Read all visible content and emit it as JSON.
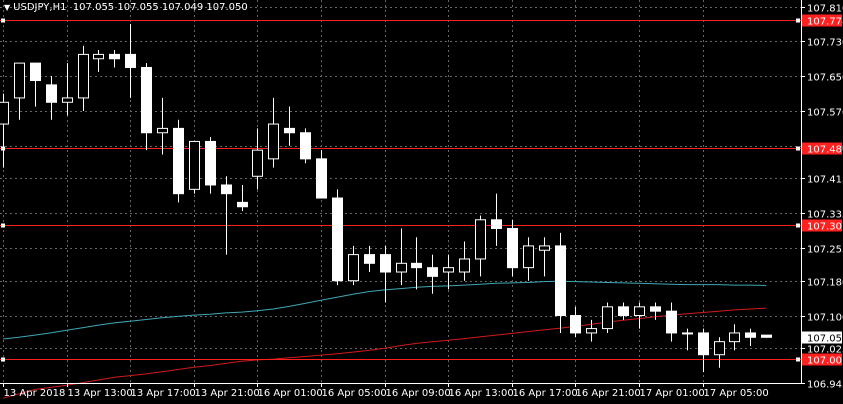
{
  "title": {
    "symbol": "USDJPY,H1",
    "ohlc": "107.055 107.055 107.049 107.050",
    "arrow_icon": "triangle-down-icon"
  },
  "colors": {
    "background": "#000000",
    "grid": "#666666",
    "frame": "#ffffff",
    "bull_body": "#000000",
    "bear_body": "#ffffff",
    "ma_fast": "#3fa7b5",
    "ma_slow": "#d11a1a",
    "hline": "#ff2020",
    "label_text": "#ffffff"
  },
  "chart_data": {
    "type": "candlestick",
    "ylim": [
      106.945,
      107.825
    ],
    "y_ticks": [
      "107.810",
      "107.730",
      "107.650",
      "107.570",
      "107.490",
      "107.415",
      "107.335",
      "107.255",
      "107.180",
      "107.100",
      "107.025",
      "106.945"
    ],
    "x_ticks": [
      "13 Apr 2018",
      "13 Apr 13:00",
      "13 Apr 17:00",
      "13 Apr 21:00",
      "16 Apr 01:00",
      "16 Apr 05:00",
      "16 Apr 09:00",
      "16 Apr 13:00",
      "16 Apr 17:00",
      "16 Apr 21:00",
      "17 Apr 01:00",
      "17 Apr 05:00"
    ],
    "x_tick_index": [
      0,
      4,
      8,
      12,
      16,
      20,
      24,
      28,
      32,
      36,
      40,
      44
    ],
    "current_price": "107.050",
    "horizontal_levels": [
      {
        "value": 107.778,
        "label": "107.778"
      },
      {
        "value": 107.486,
        "label": "107.486"
      },
      {
        "value": 107.307,
        "label": "107.307"
      },
      {
        "value": 107.001,
        "label": "107.001"
      }
    ],
    "candles": [
      {
        "o": 107.54,
        "h": 107.61,
        "l": 107.44,
        "c": 107.59
      },
      {
        "o": 107.6,
        "h": 107.68,
        "l": 107.55,
        "c": 107.68
      },
      {
        "o": 107.68,
        "h": 107.68,
        "l": 107.58,
        "c": 107.64
      },
      {
        "o": 107.63,
        "h": 107.65,
        "l": 107.55,
        "c": 107.59
      },
      {
        "o": 107.59,
        "h": 107.68,
        "l": 107.56,
        "c": 107.6
      },
      {
        "o": 107.6,
        "h": 107.72,
        "l": 107.57,
        "c": 107.7
      },
      {
        "o": 107.69,
        "h": 107.71,
        "l": 107.66,
        "c": 107.7
      },
      {
        "o": 107.7,
        "h": 107.71,
        "l": 107.67,
        "c": 107.69
      },
      {
        "o": 107.7,
        "h": 107.77,
        "l": 107.6,
        "c": 107.67
      },
      {
        "o": 107.67,
        "h": 107.68,
        "l": 107.48,
        "c": 107.52
      },
      {
        "o": 107.52,
        "h": 107.6,
        "l": 107.47,
        "c": 107.53
      },
      {
        "o": 107.53,
        "h": 107.55,
        "l": 107.36,
        "c": 107.38
      },
      {
        "o": 107.39,
        "h": 107.5,
        "l": 107.38,
        "c": 107.5
      },
      {
        "o": 107.5,
        "h": 107.51,
        "l": 107.38,
        "c": 107.4
      },
      {
        "o": 107.4,
        "h": 107.42,
        "l": 107.24,
        "c": 107.38
      },
      {
        "o": 107.36,
        "h": 107.4,
        "l": 107.34,
        "c": 107.35
      },
      {
        "o": 107.42,
        "h": 107.53,
        "l": 107.39,
        "c": 107.48
      },
      {
        "o": 107.46,
        "h": 107.6,
        "l": 107.44,
        "c": 107.54
      },
      {
        "o": 107.53,
        "h": 107.58,
        "l": 107.49,
        "c": 107.52
      },
      {
        "o": 107.52,
        "h": 107.53,
        "l": 107.45,
        "c": 107.46
      },
      {
        "o": 107.46,
        "h": 107.48,
        "l": 107.37,
        "c": 107.37
      },
      {
        "o": 107.37,
        "h": 107.39,
        "l": 107.17,
        "c": 107.18
      },
      {
        "o": 107.18,
        "h": 107.26,
        "l": 107.17,
        "c": 107.24
      },
      {
        "o": 107.24,
        "h": 107.26,
        "l": 107.2,
        "c": 107.22
      },
      {
        "o": 107.24,
        "h": 107.26,
        "l": 107.13,
        "c": 107.2
      },
      {
        "o": 107.2,
        "h": 107.3,
        "l": 107.17,
        "c": 107.22
      },
      {
        "o": 107.22,
        "h": 107.28,
        "l": 107.16,
        "c": 107.21
      },
      {
        "o": 107.21,
        "h": 107.24,
        "l": 107.15,
        "c": 107.19
      },
      {
        "o": 107.2,
        "h": 107.24,
        "l": 107.16,
        "c": 107.21
      },
      {
        "o": 107.2,
        "h": 107.27,
        "l": 107.18,
        "c": 107.23
      },
      {
        "o": 107.23,
        "h": 107.33,
        "l": 107.19,
        "c": 107.32
      },
      {
        "o": 107.32,
        "h": 107.38,
        "l": 107.26,
        "c": 107.3
      },
      {
        "o": 107.3,
        "h": 107.32,
        "l": 107.19,
        "c": 107.21
      },
      {
        "o": 107.21,
        "h": 107.28,
        "l": 107.18,
        "c": 107.26
      },
      {
        "o": 107.25,
        "h": 107.28,
        "l": 107.19,
        "c": 107.26
      },
      {
        "o": 107.26,
        "h": 107.29,
        "l": 107.06,
        "c": 107.1
      },
      {
        "o": 107.1,
        "h": 107.12,
        "l": 107.05,
        "c": 107.06
      },
      {
        "o": 107.06,
        "h": 107.09,
        "l": 107.04,
        "c": 107.07
      },
      {
        "o": 107.07,
        "h": 107.13,
        "l": 107.06,
        "c": 107.12
      },
      {
        "o": 107.12,
        "h": 107.13,
        "l": 107.09,
        "c": 107.1
      },
      {
        "o": 107.1,
        "h": 107.13,
        "l": 107.07,
        "c": 107.12
      },
      {
        "o": 107.12,
        "h": 107.13,
        "l": 107.09,
        "c": 107.11
      },
      {
        "o": 107.11,
        "h": 107.13,
        "l": 107.04,
        "c": 107.06
      },
      {
        "o": 107.06,
        "h": 107.07,
        "l": 107.02,
        "c": 107.06
      },
      {
        "o": 107.06,
        "h": 107.07,
        "l": 106.97,
        "c": 107.01
      },
      {
        "o": 107.01,
        "h": 107.05,
        "l": 106.98,
        "c": 107.04
      },
      {
        "o": 107.04,
        "h": 107.08,
        "l": 107.02,
        "c": 107.06
      },
      {
        "o": 107.06,
        "h": 107.07,
        "l": 107.03,
        "c": 107.05
      },
      {
        "o": 107.055,
        "h": 107.055,
        "l": 107.049,
        "c": 107.05
      }
    ],
    "series": [
      {
        "values": [
          107.046,
          107.05,
          107.055,
          107.06,
          107.066,
          107.072,
          107.078,
          107.083,
          107.087,
          107.091,
          107.095,
          107.098,
          107.101,
          107.103,
          107.106,
          107.108,
          107.111,
          107.115,
          107.121,
          107.128,
          107.135,
          107.142,
          107.149,
          107.155,
          107.159,
          107.162,
          107.165,
          107.167,
          107.168,
          107.17,
          107.172,
          107.174,
          107.175,
          107.176,
          107.178,
          107.179,
          107.178,
          107.177,
          107.176,
          107.175,
          107.174,
          107.173,
          107.172,
          107.171,
          107.171,
          107.171,
          107.17,
          107.17,
          107.169
        ]
      },
      {
        "values": [
          106.91,
          106.92,
          106.93,
          106.935,
          106.94,
          106.946,
          106.952,
          106.958,
          106.962,
          106.966,
          106.971,
          106.976,
          106.981,
          106.985,
          106.99,
          106.995,
          106.998,
          107.0,
          107.003,
          107.006,
          107.009,
          107.012,
          107.016,
          107.02,
          107.025,
          107.031,
          107.036,
          107.04,
          107.043,
          107.047,
          107.051,
          107.055,
          107.059,
          107.063,
          107.067,
          107.071,
          107.075,
          107.08,
          107.085,
          107.089,
          107.093,
          107.097,
          107.101,
          107.104,
          107.107,
          107.11,
          107.113,
          107.115,
          107.117
        ]
      }
    ]
  }
}
